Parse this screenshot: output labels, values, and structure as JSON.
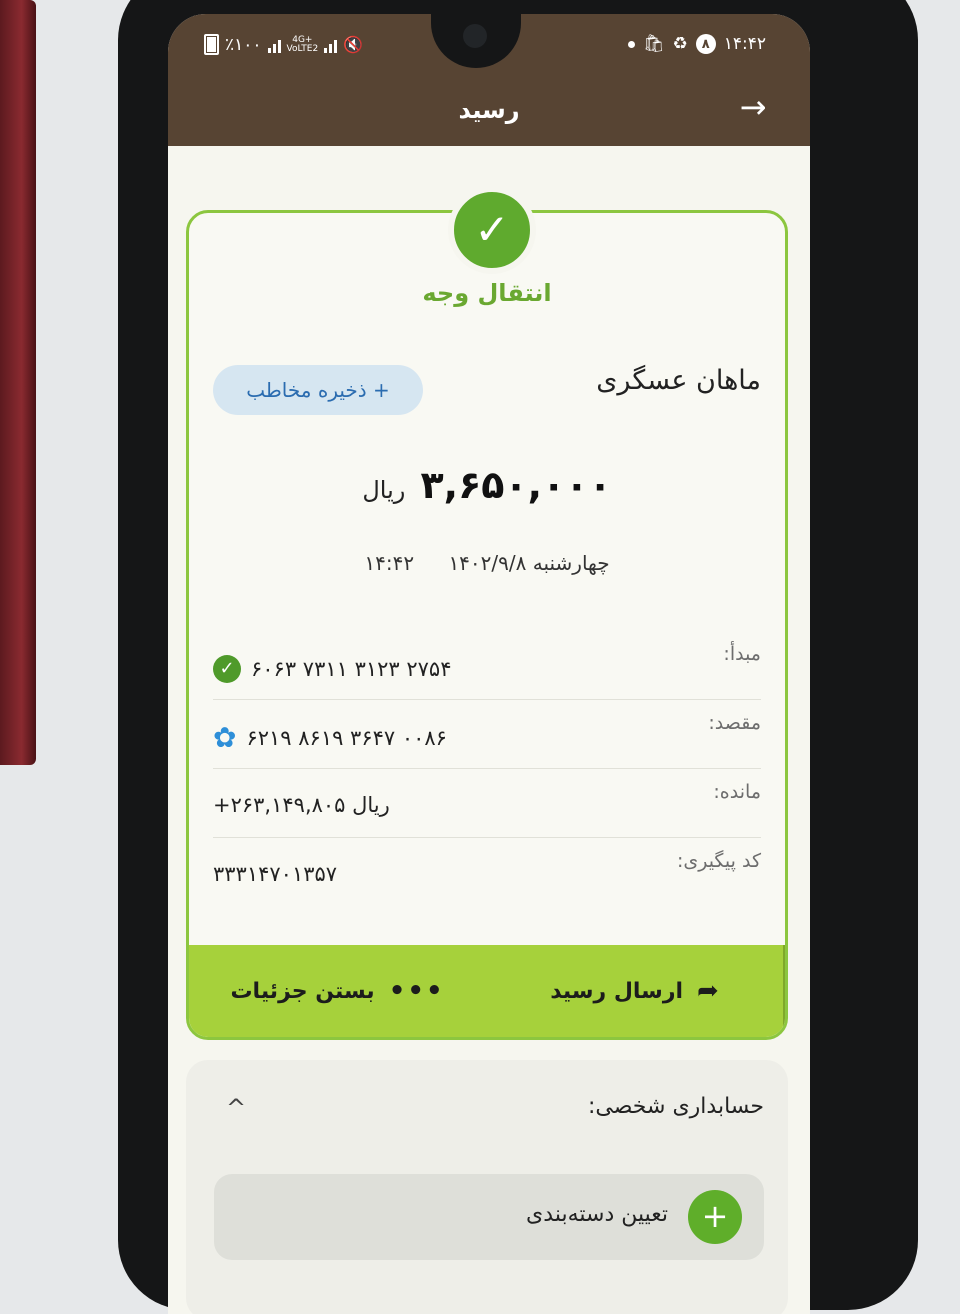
{
  "status_bar": {
    "battery": "٪۱۰۰",
    "network_1": "4G+",
    "network_2": "VoLTE2",
    "notif_count": "۸",
    "time": "۱۴:۴۲"
  },
  "header": {
    "title": "رسید"
  },
  "receipt": {
    "transaction_type": "انتقال وجه",
    "recipient_name": "ماهان عسگری",
    "save_contact_label": "+ ذخیره مخاطب",
    "amount": "۳,۶۵۰,۰۰۰",
    "currency": "ریال",
    "date": "چهارشنبه ۱۴۰۲/۹/۸",
    "time": "۱۴:۴۲",
    "rows": [
      {
        "label": "مبدأ:",
        "value": "۶۰۶۳ ۷۳۱۱ ۳۱۲۳ ۲۷۵۴",
        "icon": "check-bank-icon"
      },
      {
        "label": "مقصد:",
        "value": "۶۲۱۹ ۸۶۱۹ ۳۶۴۷ ۰۰۸۶",
        "icon": "flower-bank-icon"
      },
      {
        "label": "مانده:",
        "value": "+۲۶۳,۱۴۹,۸۰۵ ریال"
      },
      {
        "label": "کد پیگیری:",
        "value": "۳۳۳۱۴۷۰۱۳۵۷"
      }
    ],
    "actions": {
      "close_details": "بستن جزئیات",
      "send_receipt": "ارسال رسید"
    }
  },
  "accounting": {
    "title": "حسابداری شخصی:",
    "assign_category": "تعیین دسته‌بندی"
  },
  "colors": {
    "appbar": "#574433",
    "accent_green": "#8cc63f",
    "action_bar": "#a6d13b",
    "save_contact_text": "#2b6cb0"
  }
}
